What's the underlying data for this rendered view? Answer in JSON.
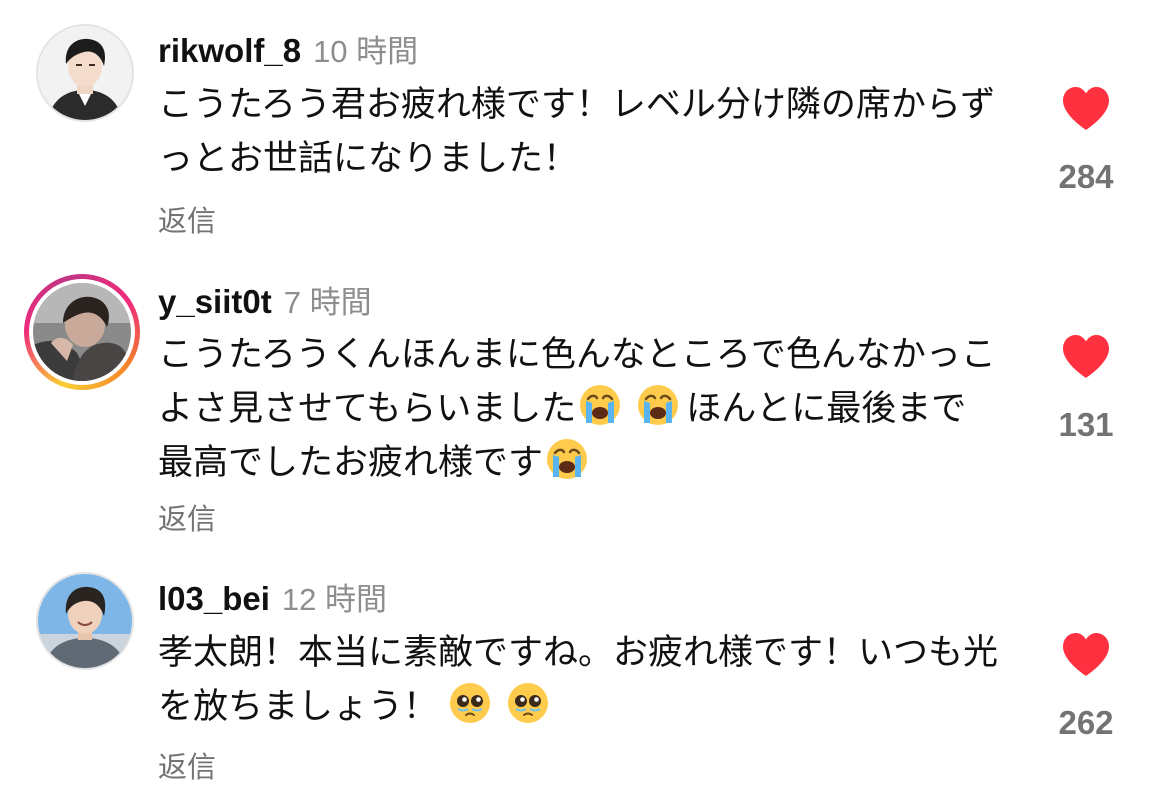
{
  "accent_color": "#ff3040",
  "comments": [
    {
      "username": "rikwolf_8",
      "time": "10 時間",
      "text": "こうたろう君お疲れ様です！レベル分け隣の席からずっとお世話になりました！",
      "reply_label": "返信",
      "likes": "284",
      "liked": true,
      "avatar_icon": "avatar-photo",
      "has_story_ring": false
    },
    {
      "username": "y_siit0t",
      "time": "7 時間",
      "text_parts": [
        "こうたろうくんほんまに色んなところで色んなかっこよさ見させてもらいました",
        "ほんとに最後まで最高でしたお疲れ様です"
      ],
      "emojis": [
        "loudly-crying-face",
        "loudly-crying-face",
        "loudly-crying-face"
      ],
      "reply_label": "返信",
      "likes": "131",
      "liked": true,
      "avatar_icon": "avatar-photo",
      "has_story_ring": true
    },
    {
      "username": "l03_bei",
      "time": "12 時間",
      "text": "孝太朗！本当に素敵ですね。お疲れ様です！いつも光を放ちましょう！",
      "emojis": [
        "pleading-face",
        "pleading-face"
      ],
      "reply_label": "返信",
      "likes": "262",
      "liked": true,
      "avatar_icon": "avatar-photo",
      "has_story_ring": false
    }
  ]
}
